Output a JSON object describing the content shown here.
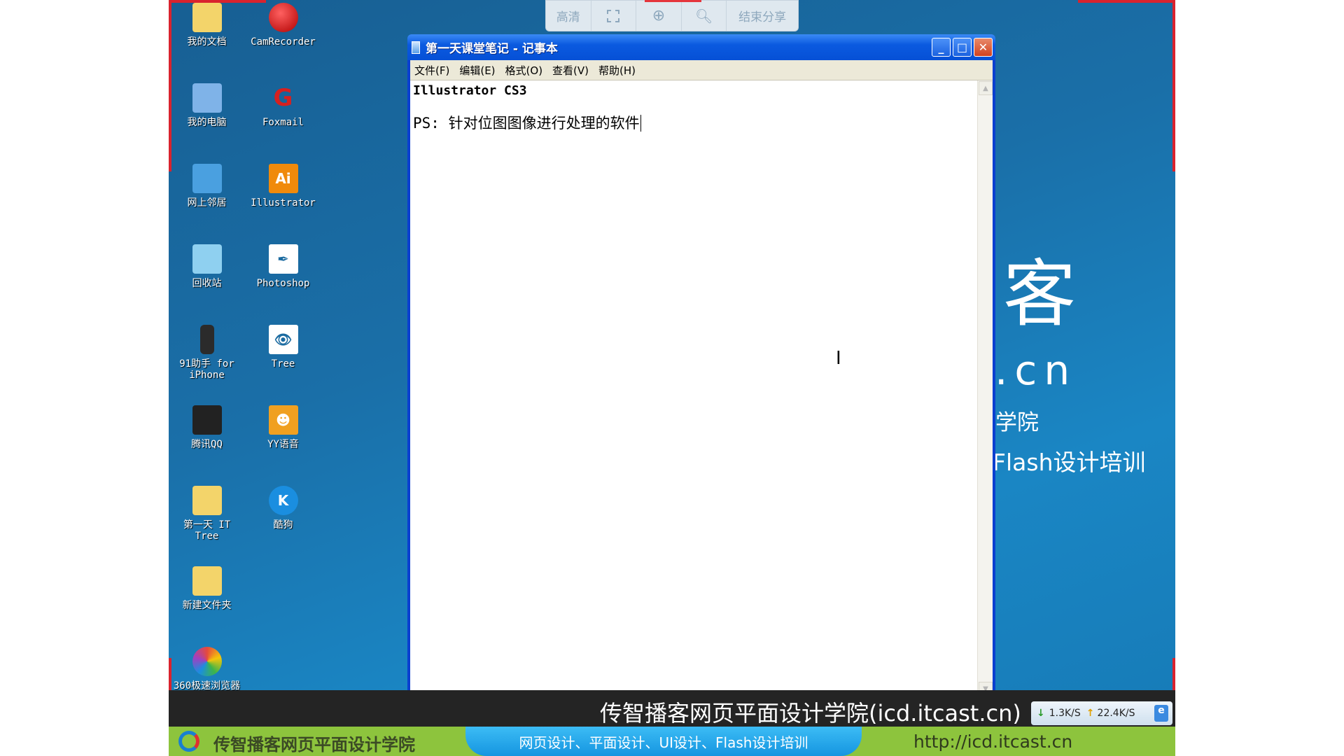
{
  "desktop": {
    "icons_left": [
      {
        "label": "我的文档",
        "icon": "my-documents-icon",
        "color": "#f3d46a"
      },
      {
        "label": "我的电脑",
        "icon": "my-computer-icon",
        "color": "#7fb3e8"
      },
      {
        "label": "网上邻居",
        "icon": "network-places-icon",
        "color": "#4aa0e0"
      },
      {
        "label": "回收站",
        "icon": "recycle-bin-icon",
        "color": "#8fd0f0"
      },
      {
        "label": "91助手 for iPhone",
        "icon": "phone-icon",
        "color": "#2b2b2b"
      },
      {
        "label": "腾讯QQ",
        "icon": "qq-penguin-icon",
        "color": "#222"
      },
      {
        "label": "第一天 IT Tree",
        "icon": "folder-icon",
        "color": "#f3d46a"
      },
      {
        "label": "新建文件夹",
        "icon": "folder-icon",
        "color": "#f3d46a"
      },
      {
        "label": "360极速浏览器",
        "icon": "browser-360-icon",
        "color": "#e64a3c"
      }
    ],
    "icons_right": [
      {
        "label": "CamRecorder",
        "icon": "record-icon",
        "color": "#d41c1c",
        "glyph": "●"
      },
      {
        "label": "Foxmail",
        "icon": "foxmail-icon",
        "color": "#d62020",
        "glyph": "G"
      },
      {
        "label": "Illustrator",
        "icon": "illustrator-icon",
        "color": "#f08a0b",
        "glyph": "Ai"
      },
      {
        "label": "Photoshop",
        "icon": "photoshop-feather-icon",
        "color": "#ffffff",
        "glyph": "✒"
      },
      {
        "label": "Tree",
        "icon": "image-eye-icon",
        "color": "#ffffff",
        "glyph": "👁"
      },
      {
        "label": "YY语音",
        "icon": "yy-icon",
        "color": "#f0a020",
        "glyph": "☻"
      },
      {
        "label": "酷狗",
        "icon": "kugou-icon",
        "color": "#1a8ee0",
        "glyph": "K"
      }
    ]
  },
  "wallpaper": {
    "big": "客",
    "domain": ".cn",
    "line1": "学院",
    "line2": "Flash设计培训"
  },
  "share_toolbar": {
    "hd": "高清",
    "end": "结束分享"
  },
  "notepad": {
    "title": "第一天课堂笔记 - 记事本",
    "menu": [
      "文件(F)",
      "编辑(E)",
      "格式(O)",
      "查看(V)",
      "帮助(H)"
    ],
    "lines": [
      "Illustrator CS3",
      "PS: 针对位图图像进行处理的软件"
    ]
  },
  "strip": {
    "text": "传智播客网页平面设计学院(icd.itcast.cn)",
    "down": "1.3K/S",
    "up": "22.4K/S"
  },
  "footer": {
    "brand": "传智播客网页平面设计学院",
    "slogan": "网页设计、平面设计、UI设计、Flash设计培训",
    "url": "http://icd.itcast.cn"
  }
}
